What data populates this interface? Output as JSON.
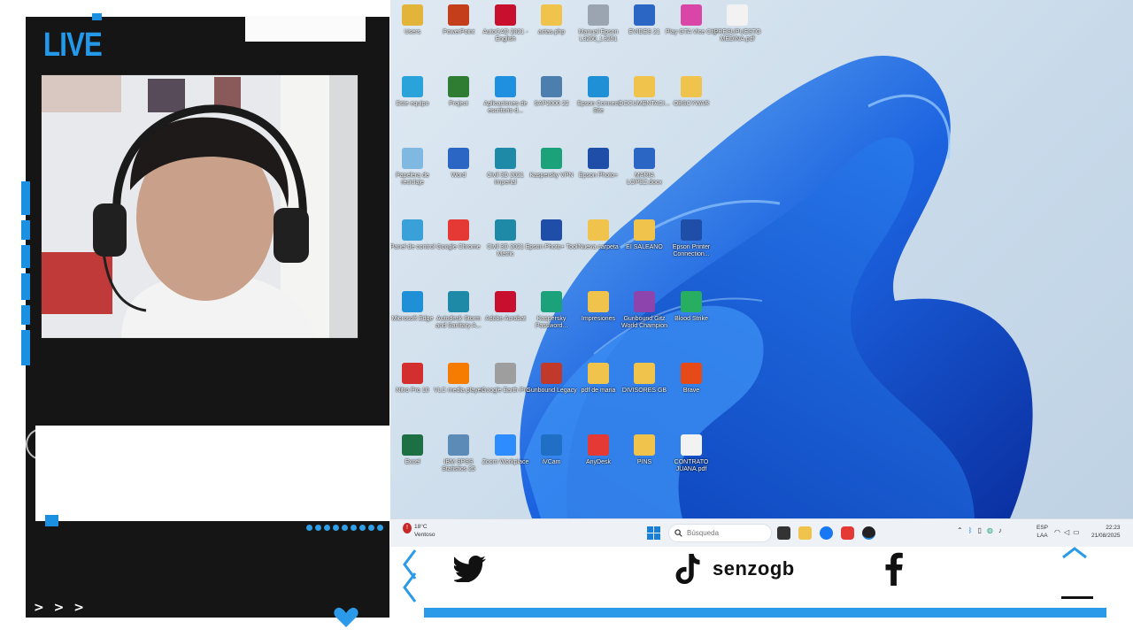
{
  "overlay": {
    "live_label": "LIVE",
    "arrows": "> > >"
  },
  "colors": {
    "accent": "#1b8fe0",
    "panel_bg": "#151515",
    "taskbar_bg": "#eef1f6"
  },
  "desktop": {
    "icons": [
      {
        "label": "Users",
        "icon": "user-folder-icon",
        "color": "#e2b43a"
      },
      {
        "label": "PowerPoint",
        "icon": "powerpoint-icon",
        "color": "#c43e1c"
      },
      {
        "label": "AutoCAD 2021 - English",
        "icon": "autocad-icon",
        "color": "#c8102e"
      },
      {
        "label": "actas.php",
        "icon": "folder-icon",
        "color": "#f0c44c"
      },
      {
        "label": "Manual Epson L3250_L3251",
        "icon": "pdf-icon",
        "color": "#9aa5b1"
      },
      {
        "label": "EVIDES 21",
        "icon": "word-doc-icon",
        "color": "#2b66c4"
      },
      {
        "label": "Play GTA Vice City",
        "icon": "game-icon",
        "color": "#d946a8"
      },
      {
        "label": "PRESUPUESTO MEDINA.pdf",
        "icon": "chrome-pdf-icon",
        "color": "#f2f2f2"
      },
      {
        "label": "Este equipo",
        "icon": "monitor-icon",
        "color": "#29a3d9"
      },
      {
        "label": "Project",
        "icon": "project-icon",
        "color": "#2e7d32"
      },
      {
        "label": "Aplicaciones de escritorio d...",
        "icon": "azure-icon",
        "color": "#1f8fe0"
      },
      {
        "label": "SAP2000 22",
        "icon": "sap-icon",
        "color": "#4d7fae"
      },
      {
        "label": "Epson Connect Site",
        "icon": "edge-icon",
        "color": "#1f8fd6"
      },
      {
        "label": "DOCUMENTACI...",
        "icon": "folder-icon",
        "color": "#f0c44c"
      },
      {
        "label": "OBSCYWAR",
        "icon": "folder-icon",
        "color": "#f0c44c"
      },
      {
        "label": "Papelera de reciclaje",
        "icon": "recycle-bin-icon",
        "color": "#7fb8e0"
      },
      {
        "label": "Word",
        "icon": "word-icon",
        "color": "#2b66c4"
      },
      {
        "label": "Civil 3D 2021 Imperial",
        "icon": "civil3d-icon",
        "color": "#1e8aa8"
      },
      {
        "label": "Kaspersky VPN",
        "icon": "kaspersky-vpn-icon",
        "color": "#1ba27a"
      },
      {
        "label": "Epson Photo+",
        "icon": "epson-photo-icon",
        "color": "#1f4ea8"
      },
      {
        "label": "MARIA LOPEZ.docx",
        "icon": "word-doc-icon",
        "color": "#2b66c4"
      },
      {
        "label": "Panel de control",
        "icon": "control-panel-icon",
        "color": "#3aa0d8"
      },
      {
        "label": "Google Chrome",
        "icon": "chrome-icon",
        "color": "#e53935"
      },
      {
        "label": "Civil 3D 2021 Metric",
        "icon": "civil3d-icon",
        "color": "#1e8aa8"
      },
      {
        "label": "Epson Photo+ Tool",
        "icon": "epson-tool-icon",
        "color": "#1f4ea8"
      },
      {
        "label": "Nueva carpeta",
        "icon": "folder-icon",
        "color": "#f0c44c"
      },
      {
        "label": "EI SALEANO",
        "icon": "folder-icon",
        "color": "#f0c44c"
      },
      {
        "label": "Epson Printer Connection...",
        "icon": "epson-printer-icon",
        "color": "#1f4ea8"
      },
      {
        "label": "Microsoft Edge",
        "icon": "edge-icon",
        "color": "#1f8fd6"
      },
      {
        "label": "Autodesk Storm and Sanitary A...",
        "icon": "autodesk-icon",
        "color": "#1e8aa8"
      },
      {
        "label": "Adobe Acrobat",
        "icon": "acrobat-icon",
        "color": "#c8102e"
      },
      {
        "label": "Kaspersky Password...",
        "icon": "kaspersky-icon",
        "color": "#1ba27a"
      },
      {
        "label": "Impresiones",
        "icon": "folder-icon",
        "color": "#f0c44c"
      },
      {
        "label": "Gunbound Gitz World Champion",
        "icon": "gunbound-icon",
        "color": "#8e44ad"
      },
      {
        "label": "Blood Strike",
        "icon": "blood-strike-icon",
        "color": "#27ae60"
      },
      {
        "label": "Nitro Pro 10",
        "icon": "nitro-icon",
        "color": "#d32f2f"
      },
      {
        "label": "VLC media player",
        "icon": "vlc-icon",
        "color": "#f57c00"
      },
      {
        "label": "Google Earth Pro",
        "icon": "google-earth-icon",
        "color": "#9e9e9e"
      },
      {
        "label": "Gunbound Legacy",
        "icon": "gunbound-icon",
        "color": "#c0392b"
      },
      {
        "label": "pdf de maria",
        "icon": "folder-icon",
        "color": "#f0c44c"
      },
      {
        "label": "DIVISORES GB",
        "icon": "folder-icon",
        "color": "#f0c44c"
      },
      {
        "label": "Brave",
        "icon": "brave-icon",
        "color": "#e64a19"
      },
      {
        "label": "Excel",
        "icon": "excel-icon",
        "color": "#1d7044"
      },
      {
        "label": "IBM SPSS Statistics 25",
        "icon": "spss-icon",
        "color": "#5d8bb8"
      },
      {
        "label": "Zoom Workplace",
        "icon": "zoom-icon",
        "color": "#2d8cff"
      },
      {
        "label": "iVCam",
        "icon": "ivcam-icon",
        "color": "#1f6fc4"
      },
      {
        "label": "AnyDesk",
        "icon": "anydesk-icon",
        "color": "#e53935"
      },
      {
        "label": "PINS",
        "icon": "folder-icon",
        "color": "#f0c44c"
      },
      {
        "label": "CONTRATO JUANA.pdf",
        "icon": "chrome-pdf-icon",
        "color": "#f2f2f2"
      }
    ]
  },
  "taskbar": {
    "weather_temp": "18°C",
    "weather_desc": "Ventoso",
    "search_placeholder": "Búsqueda",
    "lang_line1": "ESP",
    "lang_line2": "LAA",
    "time": "22:23",
    "date": "21/08/2025"
  },
  "social": {
    "handle": "senzogb"
  }
}
